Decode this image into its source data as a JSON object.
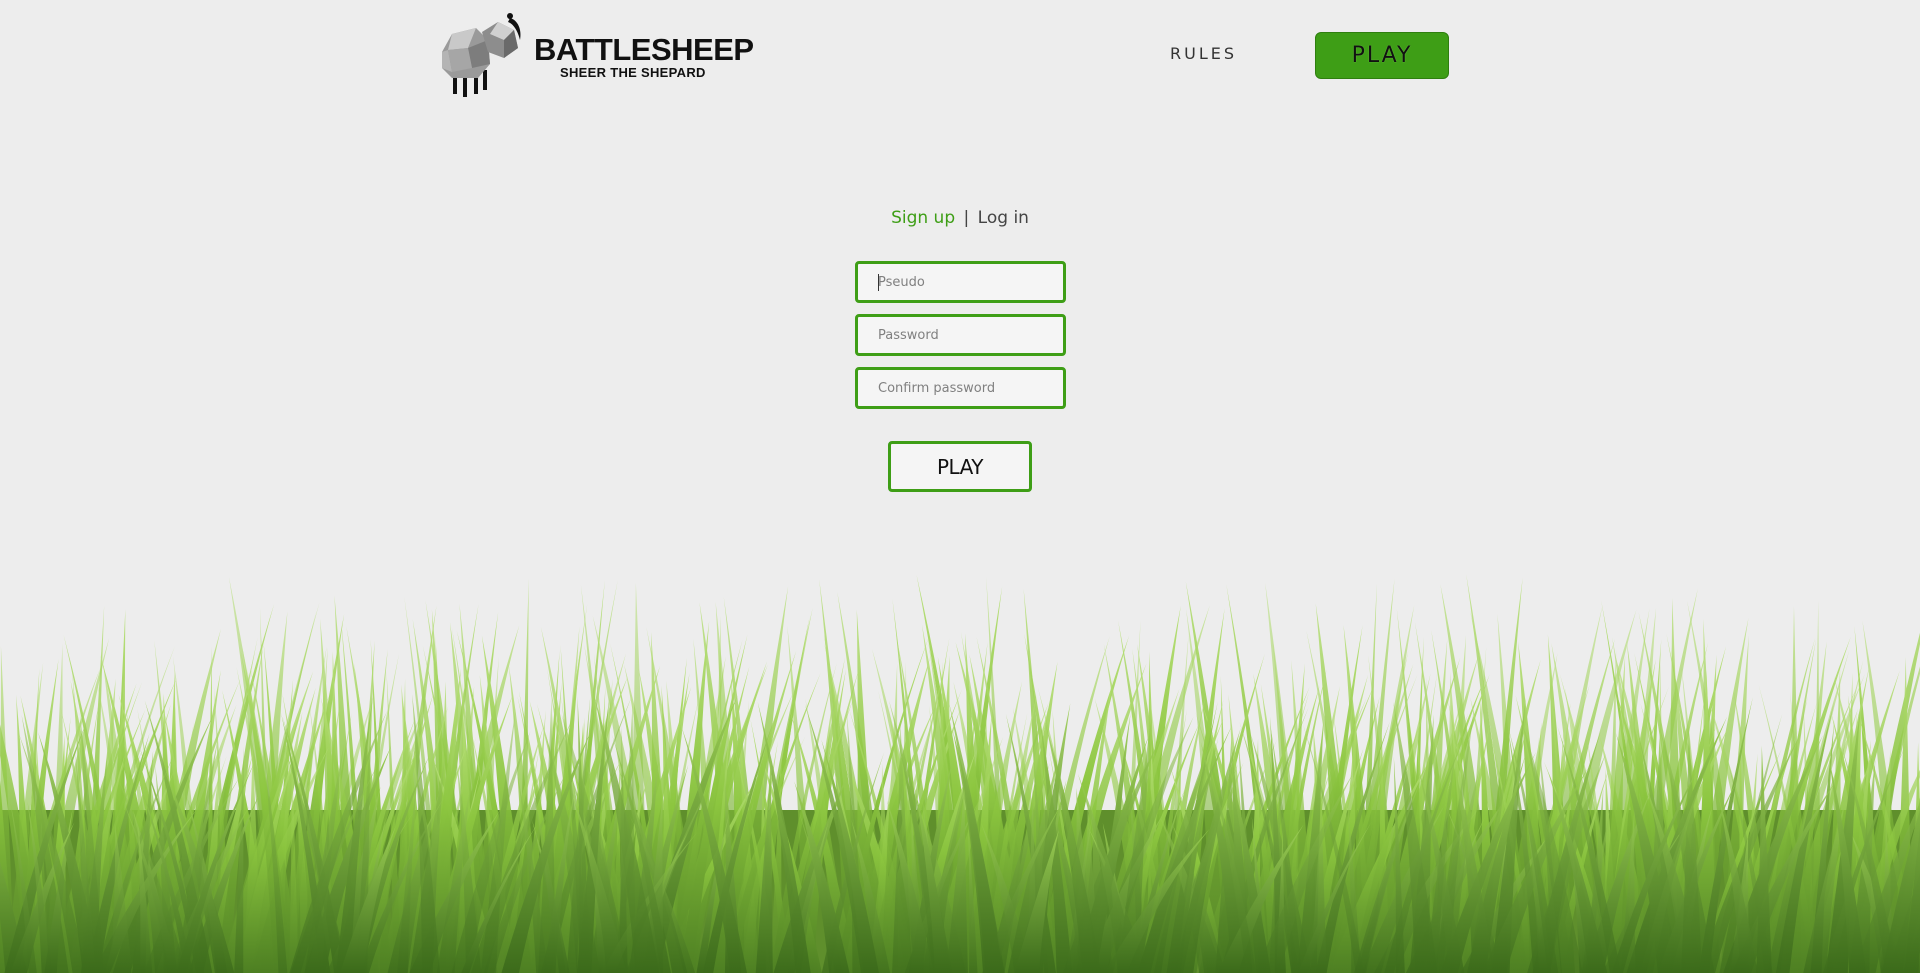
{
  "header": {
    "logo_title": "BATTLESHEEP",
    "logo_subtitle": "SHEER THE SHEPARD",
    "nav_rules": "RULES",
    "nav_play": "PLAY"
  },
  "auth": {
    "signup_label": "Sign up",
    "separator": "|",
    "login_label": "Log in",
    "pseudo_placeholder": "Pseudo",
    "password_placeholder": "Password",
    "confirm_placeholder": "Confirm password",
    "submit_label": "PLAY"
  },
  "theme": {
    "accent": "#3e9e16",
    "background": "#ededed",
    "grass_light": "#9fd04a",
    "grass_dark": "#3f6e1c"
  },
  "icons": {
    "logo": "sheep-logo-icon",
    "footer_decoration": "grass-decoration"
  }
}
